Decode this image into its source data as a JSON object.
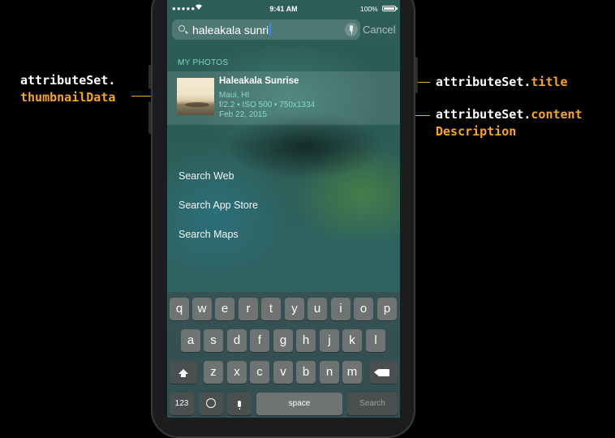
{
  "annotations": {
    "thumbnail": {
      "line1": "attributeSet.",
      "line2": "thumbnailData"
    },
    "title": {
      "prefix": "attributeSet.",
      "key": "title"
    },
    "content": {
      "prefix": "attributeSet.",
      "key1": "content",
      "key2": "Description"
    }
  },
  "status_bar": {
    "signal": "●●●●●",
    "time": "9:41 AM",
    "battery": "100%"
  },
  "search": {
    "query": "haleakala sunri",
    "cancel_label": "Cancel"
  },
  "results": {
    "section_header": "MY PHOTOS",
    "item": {
      "title": "Haleakala Sunrise",
      "description_lines": [
        "Maui, HI",
        "f/2.2 • ISO 500 • 750x1334",
        "Feb 22, 2015"
      ]
    }
  },
  "actions": [
    "Search Web",
    "Search App Store",
    "Search Maps"
  ],
  "keyboard": {
    "row1": [
      "q",
      "w",
      "e",
      "r",
      "t",
      "y",
      "u",
      "i",
      "o",
      "p"
    ],
    "row2": [
      "a",
      "s",
      "d",
      "f",
      "g",
      "h",
      "j",
      "k",
      "l"
    ],
    "row3": [
      "z",
      "x",
      "c",
      "v",
      "b",
      "n",
      "m"
    ],
    "numbers_label": "123",
    "space_label": "space",
    "search_label": "Search"
  },
  "colors": {
    "accent_orange": "#f5a623",
    "result_teal": "#86d9cf",
    "header_teal": "#7fd3c4"
  }
}
